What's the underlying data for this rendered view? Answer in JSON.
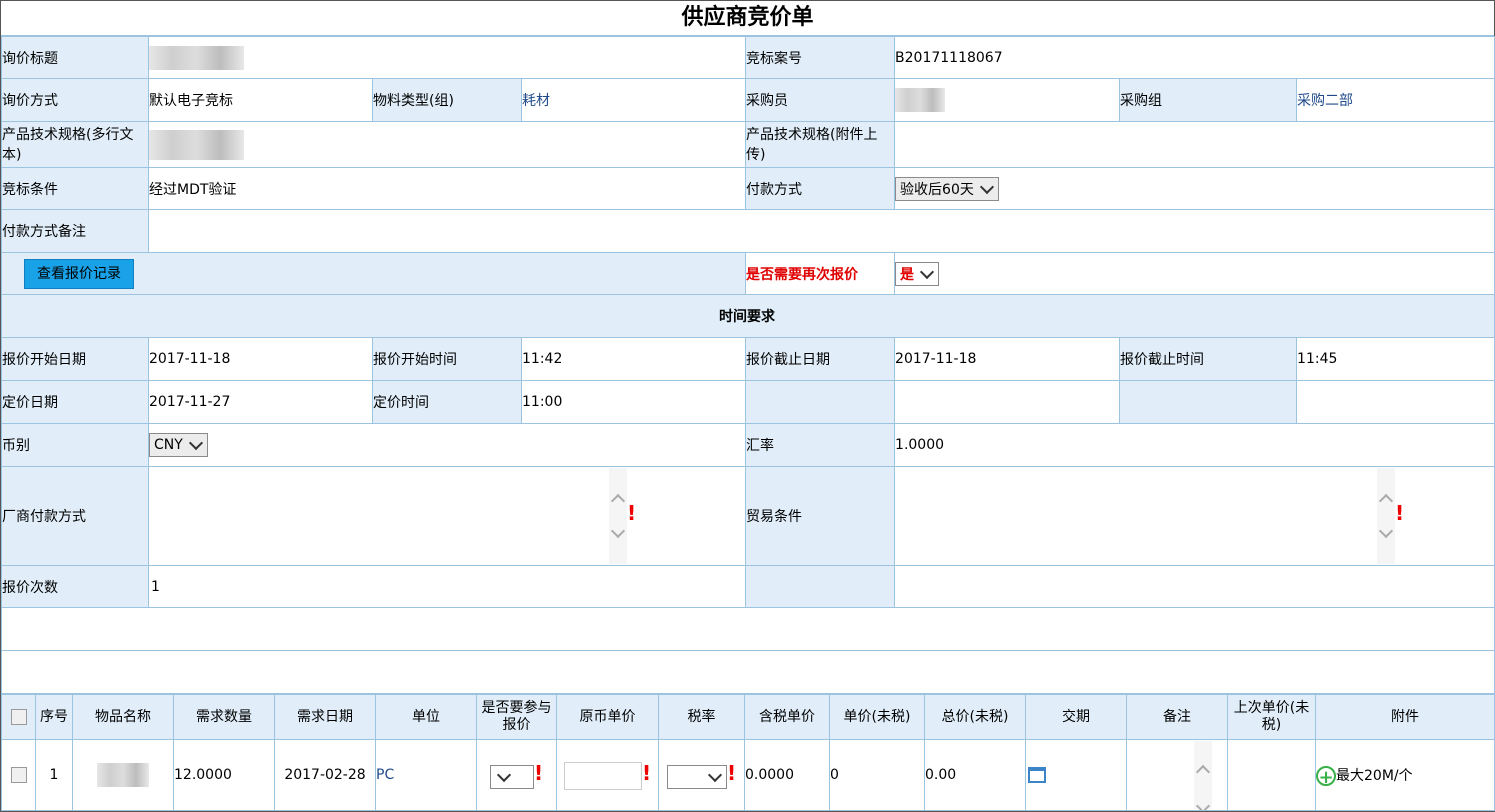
{
  "page_title": "供应商竞价单",
  "header": {
    "inquiry_title_label": "询价标题",
    "bid_case_no_label": "竞标案号",
    "bid_case_no": "B20171118067",
    "inquiry_method_label": "询价方式",
    "inquiry_method": "默认电子竞标",
    "material_type_label": "物料类型(组)",
    "material_type": "耗材",
    "buyer_label": "采购员",
    "purchase_group_label": "采购组",
    "purchase_group": "采购二部",
    "spec_text_label": "产品技术规格(多行文本)",
    "spec_attach_label": "产品技术规格(附件上传)",
    "bid_condition_label": "竞标条件",
    "bid_condition": "经过MDT验证",
    "payment_method_label": "付款方式",
    "payment_method": "验收后60天",
    "payment_note_label": "付款方式备注",
    "view_records_button": "查看报价记录",
    "requote_label": "是否需要再次报价",
    "requote_value": "是"
  },
  "time": {
    "section_title": "时间要求",
    "quote_start_date_label": "报价开始日期",
    "quote_start_date": "2017-11-18",
    "quote_start_time_label": "报价开始时间",
    "quote_start_time": "11:42",
    "quote_end_date_label": "报价截止日期",
    "quote_end_date": "2017-11-18",
    "quote_end_time_label": "报价截止时间",
    "quote_end_time": "11:45",
    "pricing_date_label": "定价日期",
    "pricing_date": "2017-11-27",
    "pricing_time_label": "定价时间",
    "pricing_time": "11:00",
    "currency_label": "币别",
    "currency": "CNY",
    "exchange_rate_label": "汇率",
    "exchange_rate": "1.0000",
    "vendor_payment_label": "厂商付款方式",
    "trade_terms_label": "贸易条件",
    "quote_count_label": "报价次数",
    "quote_count": "1"
  },
  "items": {
    "columns": [
      "序号",
      "物品名称",
      "需求数量",
      "需求日期",
      "单位",
      "是否要参与报价",
      "原币单价",
      "税率",
      "含税单价",
      "单价(未税)",
      "总价(未税)",
      "交期",
      "备注",
      "上次单价(未税)",
      "附件"
    ],
    "rows": [
      {
        "seq": "1",
        "qty": "12.0000",
        "date": "2017-02-28",
        "unit": "PC",
        "tax_price": "0.0000",
        "unit_price": "0",
        "total": "0.00",
        "attachment": "最大20M/个"
      }
    ]
  },
  "icons": [
    "chevron-down-icon",
    "calendar-icon",
    "add-circle-icon",
    "required-icon"
  ],
  "colors": {
    "label_bg": "#e1eef9",
    "border": "#9cc3e0",
    "button": "#1aa2e8",
    "required": "#e00000",
    "link": "#1f4a8a"
  }
}
